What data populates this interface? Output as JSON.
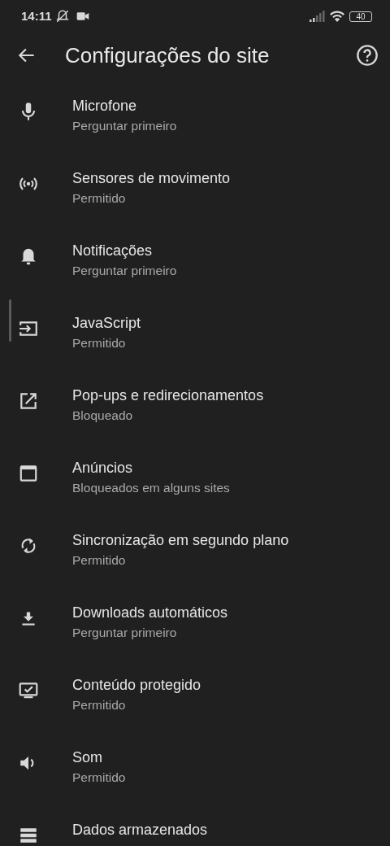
{
  "status_bar": {
    "time": "14:11",
    "battery": "40"
  },
  "toolbar": {
    "title": "Configurações do site"
  },
  "settings": [
    {
      "title": "Microfone",
      "value": "Perguntar primeiro"
    },
    {
      "title": "Sensores de movimento",
      "value": "Permitido"
    },
    {
      "title": "Notificações",
      "value": "Perguntar primeiro"
    },
    {
      "title": "JavaScript",
      "value": "Permitido"
    },
    {
      "title": "Pop-ups e redirecionamentos",
      "value": "Bloqueado"
    },
    {
      "title": "Anúncios",
      "value": "Bloqueados em alguns sites"
    },
    {
      "title": "Sincronização em segundo plano",
      "value": "Permitido"
    },
    {
      "title": "Downloads automáticos",
      "value": "Perguntar primeiro"
    },
    {
      "title": "Conteúdo protegido",
      "value": "Permitido"
    },
    {
      "title": "Som",
      "value": "Permitido"
    },
    {
      "title": "Dados armazenados"
    }
  ]
}
